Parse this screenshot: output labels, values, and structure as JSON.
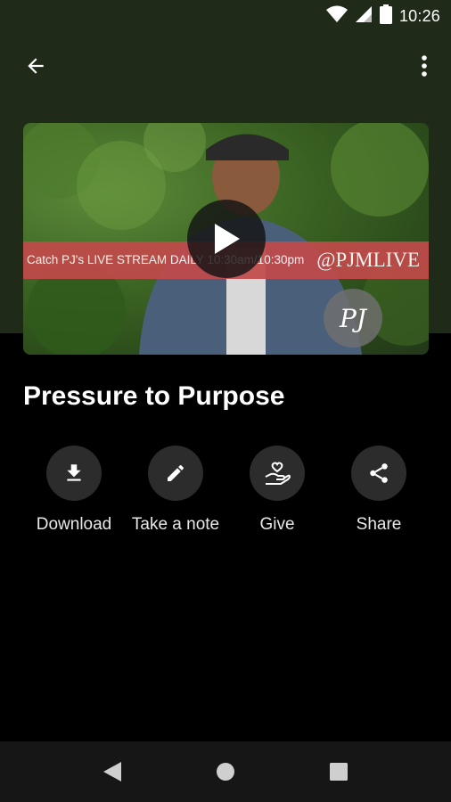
{
  "status_bar": {
    "time": "10:26"
  },
  "app_bar": {
    "back_icon": "arrow-back-icon",
    "more_icon": "more-vert-icon"
  },
  "video": {
    "banner_left": "Catch PJ's LIVE STREAM DAILY 10:30am/10:30pm",
    "banner_right": "@PJMLIVE",
    "logo_text": "PJ",
    "play_icon": "play-icon"
  },
  "title": "Pressure to Purpose",
  "actions": [
    {
      "label": "Download",
      "icon": "download-icon"
    },
    {
      "label": "Take a note",
      "icon": "pencil-icon"
    },
    {
      "label": "Give",
      "icon": "give-heart-hand-icon"
    },
    {
      "label": "Share",
      "icon": "share-icon"
    }
  ],
  "colors": {
    "hero": "#1f2a18",
    "banner": "#c24a4a",
    "action_circle": "#2c2c2c",
    "nav": "#161616"
  }
}
